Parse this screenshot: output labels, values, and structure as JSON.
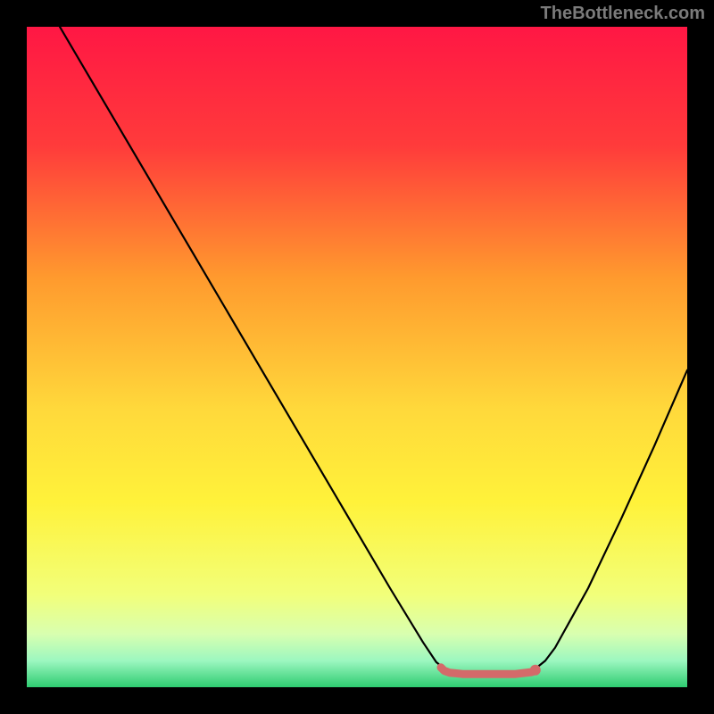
{
  "watermark": "TheBottleneck.com",
  "chart_data": {
    "type": "line",
    "title": "",
    "xlabel": "",
    "ylabel": "",
    "xlim": [
      0,
      100
    ],
    "ylim": [
      0,
      100
    ],
    "gradient_stops": [
      {
        "offset": 0,
        "color": "#ff1744"
      },
      {
        "offset": 18,
        "color": "#ff3b3b"
      },
      {
        "offset": 38,
        "color": "#ff9a2e"
      },
      {
        "offset": 58,
        "color": "#ffd93b"
      },
      {
        "offset": 72,
        "color": "#fff23a"
      },
      {
        "offset": 86,
        "color": "#f2ff7a"
      },
      {
        "offset": 92,
        "color": "#d8ffb0"
      },
      {
        "offset": 96,
        "color": "#9cf7c0"
      },
      {
        "offset": 100,
        "color": "#2ecc71"
      }
    ],
    "series": [
      {
        "name": "bottleneck-curve",
        "color": "#000000",
        "points": [
          {
            "x": 5.0,
            "y": 100.0
          },
          {
            "x": 10.0,
            "y": 91.5
          },
          {
            "x": 15.0,
            "y": 83.0
          },
          {
            "x": 20.0,
            "y": 74.5
          },
          {
            "x": 25.0,
            "y": 66.0
          },
          {
            "x": 30.0,
            "y": 57.5
          },
          {
            "x": 35.0,
            "y": 49.0
          },
          {
            "x": 40.0,
            "y": 40.5
          },
          {
            "x": 45.0,
            "y": 32.0
          },
          {
            "x": 50.0,
            "y": 23.5
          },
          {
            "x": 55.0,
            "y": 15.0
          },
          {
            "x": 60.0,
            "y": 6.8
          },
          {
            "x": 62.0,
            "y": 3.8
          },
          {
            "x": 63.5,
            "y": 2.6
          },
          {
            "x": 65.0,
            "y": 2.2
          },
          {
            "x": 68.0,
            "y": 2.0
          },
          {
            "x": 72.0,
            "y": 2.0
          },
          {
            "x": 75.0,
            "y": 2.2
          },
          {
            "x": 77.0,
            "y": 2.8
          },
          {
            "x": 78.5,
            "y": 4.0
          },
          {
            "x": 80.0,
            "y": 6.0
          },
          {
            "x": 85.0,
            "y": 15.0
          },
          {
            "x": 90.0,
            "y": 25.5
          },
          {
            "x": 95.0,
            "y": 36.5
          },
          {
            "x": 100.0,
            "y": 48.0
          }
        ]
      },
      {
        "name": "optimal-range-marker",
        "color": "#d46a6a",
        "points": [
          {
            "x": 62.7,
            "y": 3.0
          },
          {
            "x": 63.2,
            "y": 2.5
          },
          {
            "x": 64.0,
            "y": 2.2
          },
          {
            "x": 66.0,
            "y": 2.0
          },
          {
            "x": 70.0,
            "y": 2.0
          },
          {
            "x": 74.0,
            "y": 2.0
          },
          {
            "x": 76.5,
            "y": 2.3
          }
        ],
        "end_dot": {
          "x": 77.0,
          "y": 2.6
        }
      }
    ]
  }
}
